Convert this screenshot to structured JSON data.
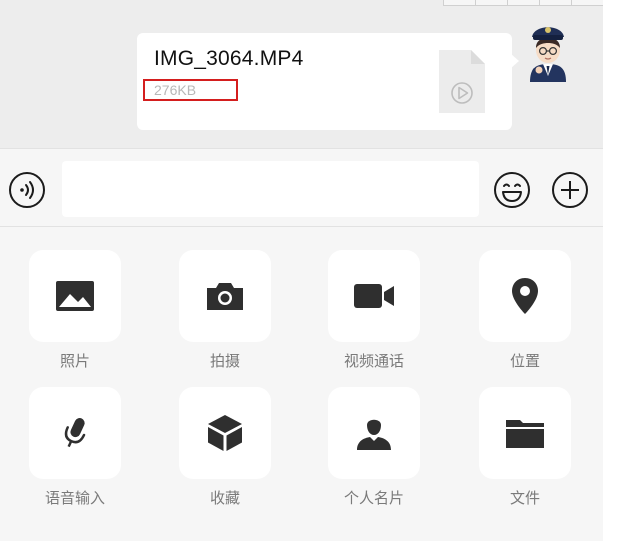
{
  "message": {
    "file_name": "IMG_3064.MP4",
    "file_size": "276KB"
  },
  "input": {
    "placeholder": ""
  },
  "panel": {
    "items": [
      {
        "label": "照片",
        "icon": "photo-icon"
      },
      {
        "label": "拍摄",
        "icon": "camera-icon"
      },
      {
        "label": "视频通话",
        "icon": "video-call-icon"
      },
      {
        "label": "位置",
        "icon": "location-pin-icon"
      },
      {
        "label": "语音输入",
        "icon": "microphone-icon"
      },
      {
        "label": "收藏",
        "icon": "favorites-box-icon"
      },
      {
        "label": "个人名片",
        "icon": "contact-card-icon"
      },
      {
        "label": "文件",
        "icon": "folder-icon"
      }
    ]
  },
  "colors": {
    "chat_background": "#ededed",
    "panel_background": "#f6f6f6",
    "icon_color": "#2f2f2f",
    "highlight_box": "#d41e1e"
  }
}
